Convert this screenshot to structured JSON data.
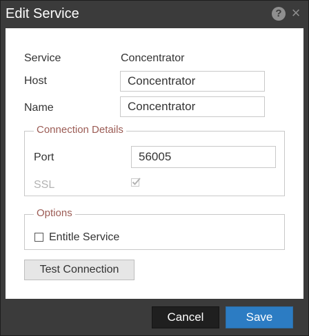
{
  "dialog": {
    "title": "Edit Service",
    "help_glyph": "?",
    "close_glyph": "×"
  },
  "service": {
    "label": "Service",
    "value": "Concentrator"
  },
  "host": {
    "label": "Host",
    "value": "Concentrator"
  },
  "name": {
    "label": "Name",
    "value": "Concentrator"
  },
  "connection": {
    "legend": "Connection Details",
    "port_label": "Port",
    "port_value": "56005",
    "ssl_label": "SSL",
    "ssl_checked": true,
    "ssl_disabled": true
  },
  "options": {
    "legend": "Options",
    "entitle_label": "Entitle Service",
    "entitle_checked": false
  },
  "buttons": {
    "test_connection": "Test Connection",
    "cancel": "Cancel",
    "save": "Save"
  },
  "colors": {
    "title_bar": "#3b3b3b",
    "legend_text": "#9b5b54",
    "save_button": "#2c7cc3",
    "cancel_button": "#1f1f1f"
  },
  "icons": {
    "help": "help-icon",
    "close": "close-icon",
    "ssl_check": "checkmark-icon"
  }
}
